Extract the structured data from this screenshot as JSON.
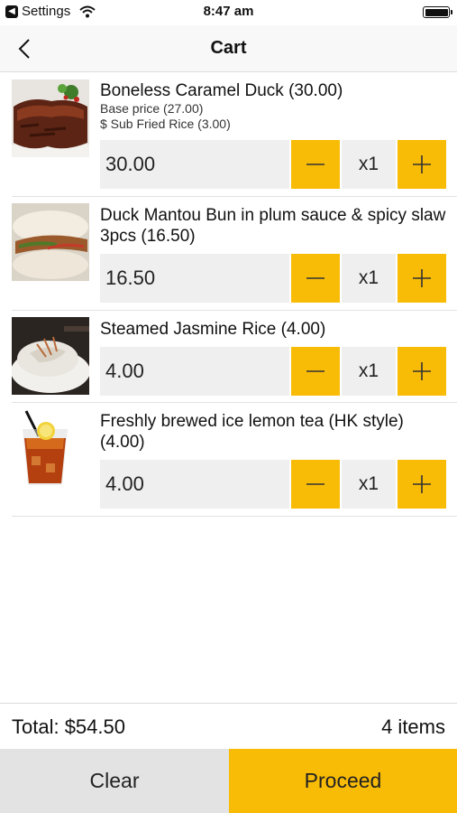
{
  "status_bar": {
    "back_app": "Settings",
    "time": "8:47 am"
  },
  "nav": {
    "title": "Cart",
    "back_icon": "chevron-left-icon"
  },
  "cart": {
    "items": [
      {
        "name": "Boneless Caramel Duck (30.00)",
        "subs": [
          "Base price (27.00)",
          "$ Sub Fried Rice (3.00)"
        ],
        "price": "30.00",
        "quantity": "x1",
        "image": "roast-duck-photo"
      },
      {
        "name": "Duck Mantou Bun in plum sauce & spicy slaw 3pcs (16.50)",
        "subs": [],
        "price": "16.50",
        "quantity": "x1",
        "image": "mantou-bun-photo"
      },
      {
        "name": "Steamed Jasmine Rice (4.00)",
        "subs": [],
        "price": "4.00",
        "quantity": "x1",
        "image": "jasmine-rice-photo"
      },
      {
        "name": "Freshly brewed ice lemon tea (HK style) (4.00)",
        "subs": [],
        "price": "4.00",
        "quantity": "x1",
        "image": "lemon-tea-photo"
      }
    ],
    "minus_symbol": "—",
    "plus_symbol": "+"
  },
  "summary": {
    "total": "Total: $54.50",
    "count": "4 items"
  },
  "actions": {
    "clear_label": "Clear",
    "proceed_label": "Proceed"
  },
  "colors": {
    "accent": "#f9bc06",
    "field_bg": "#efefef",
    "clear_bg": "#e3e3e3"
  }
}
